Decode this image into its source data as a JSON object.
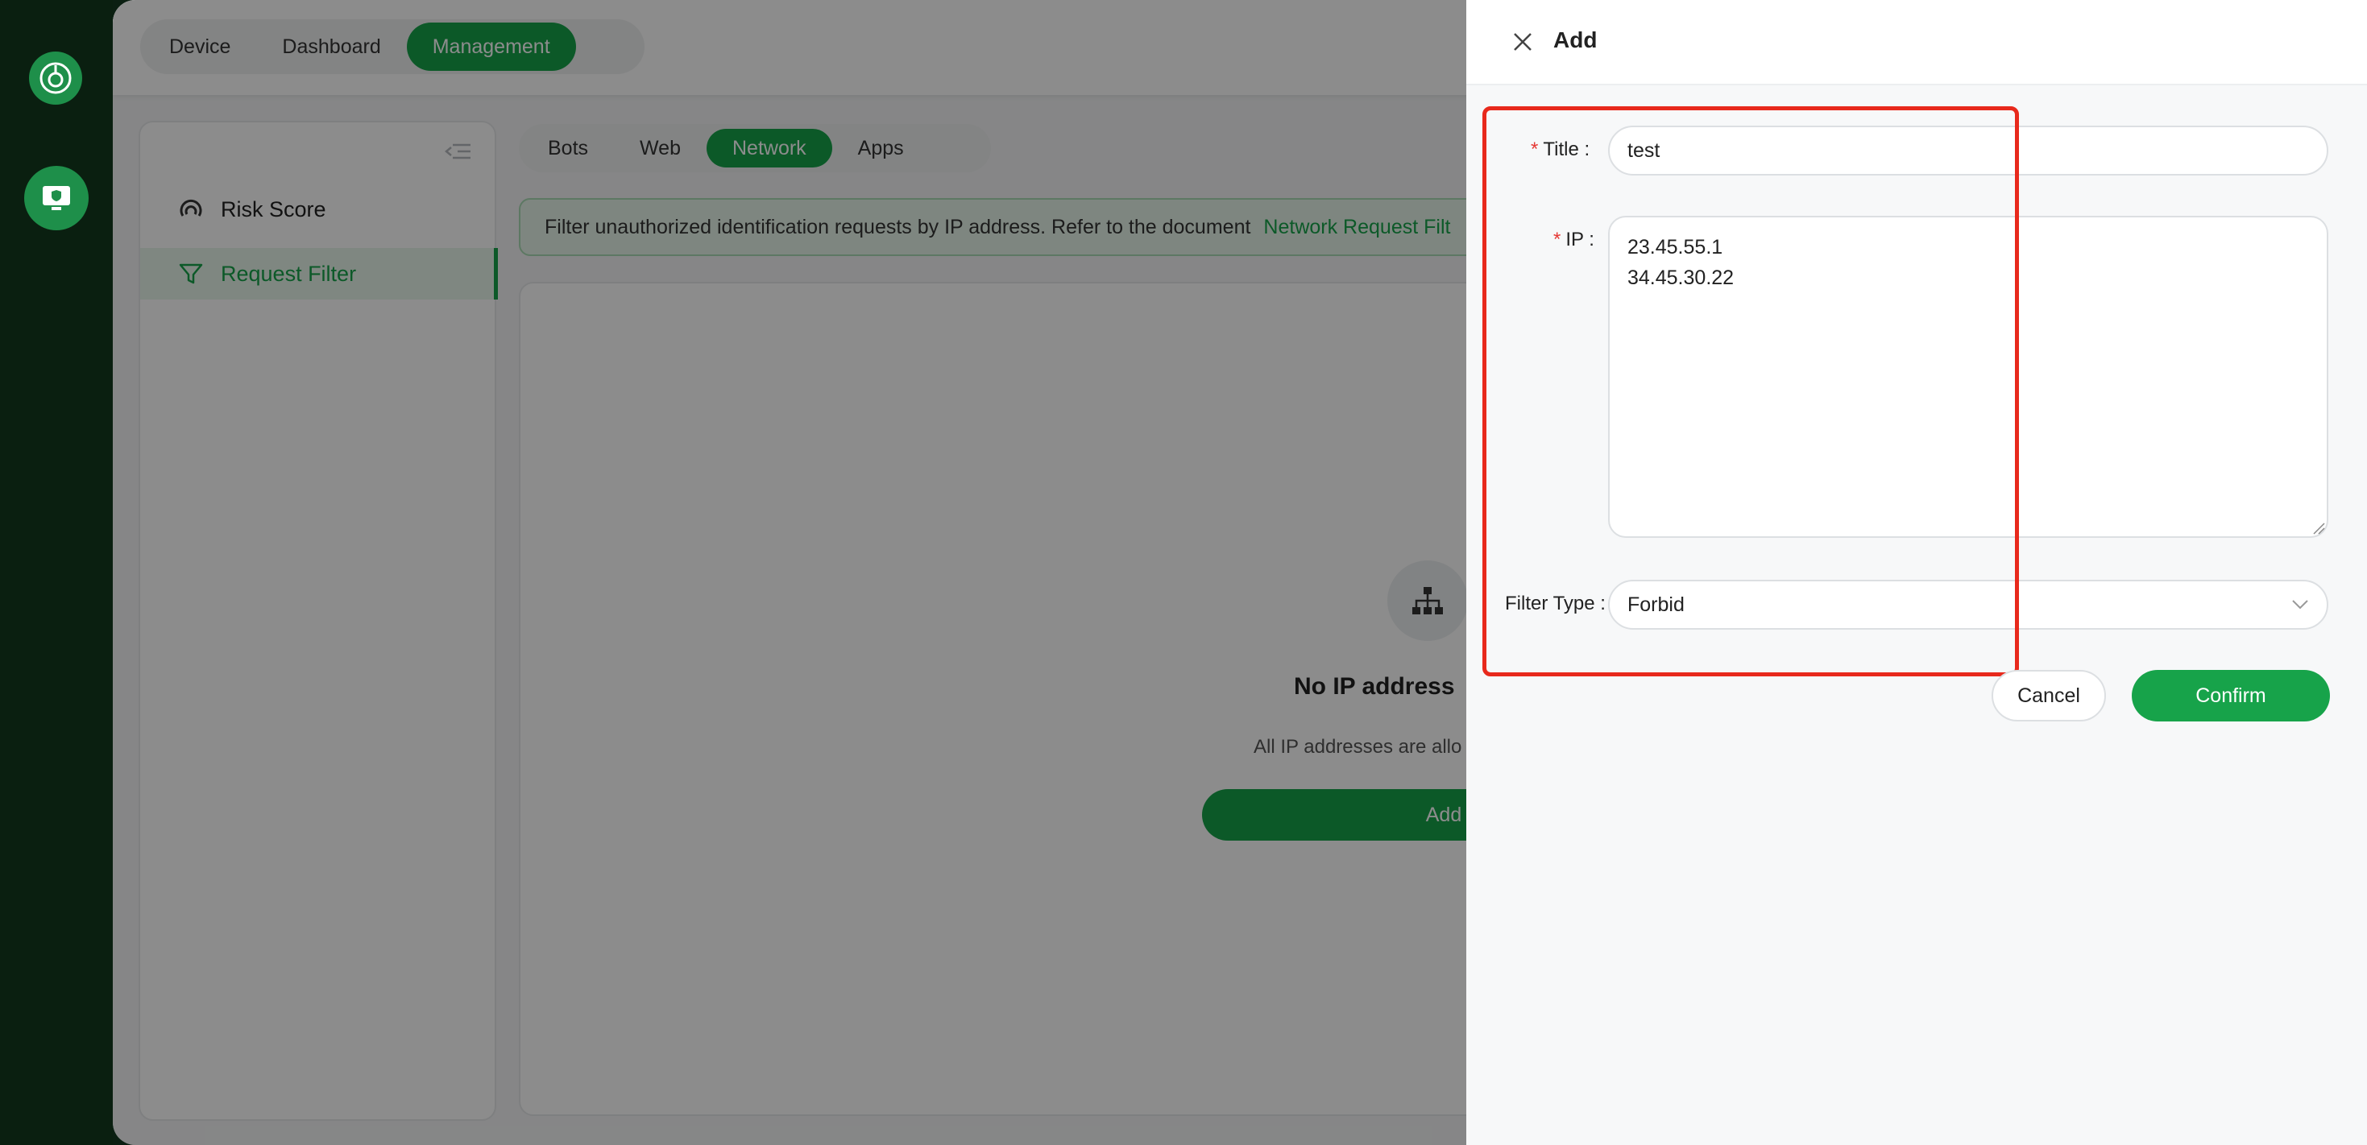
{
  "rail": {
    "logo_icon": "app-logo-icon",
    "nav_icon": "shield-monitor-icon"
  },
  "top_tabs": [
    {
      "label": "Device",
      "active": false
    },
    {
      "label": "Dashboard",
      "active": false
    },
    {
      "label": "Management",
      "active": true
    }
  ],
  "sidebar": {
    "collapse_icon": "collapse-menu-icon",
    "items": [
      {
        "label": "Risk Score",
        "icon": "gauge-icon",
        "active": false
      },
      {
        "label": "Request Filter",
        "icon": "filter-icon",
        "active": true
      }
    ]
  },
  "sub_tabs": [
    {
      "label": "Bots",
      "active": false
    },
    {
      "label": "Web",
      "active": false
    },
    {
      "label": "Network",
      "active": true
    },
    {
      "label": "Apps",
      "active": false
    }
  ],
  "notice": {
    "text": "Filter unauthorized identification requests by IP address. Refer to the document",
    "link": "Network Request Filt"
  },
  "empty_state": {
    "icon": "network-tree-icon",
    "title": "No IP address",
    "subtitle": "All IP addresses are allo",
    "add_label": "Add"
  },
  "drawer": {
    "title": "Add",
    "close_icon": "close-icon",
    "fields": {
      "title_label": "Title",
      "title_value": "test",
      "ip_label": "IP",
      "ip_value": "23.45.55.1\n34.45.30.22",
      "filter_type_label": "Filter Type",
      "filter_type_value": "Forbid"
    },
    "cancel_label": "Cancel",
    "confirm_label": "Confirm"
  },
  "colors": {
    "brand": "#17a34a",
    "highlight": "#e8291c",
    "required": "#e53935"
  }
}
